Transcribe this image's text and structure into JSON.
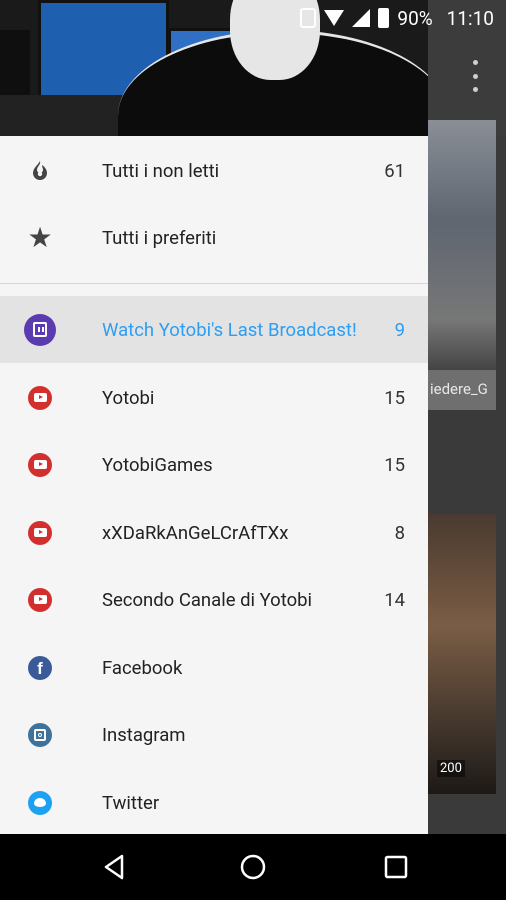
{
  "status_bar": {
    "battery": "90%",
    "time": "11:10"
  },
  "background": {
    "caption_fragment": "iedere_G",
    "video_time": "200"
  },
  "drawer": {
    "items": [
      {
        "label": "Tutti i non letti",
        "count": "61",
        "icon": "flame-icon"
      },
      {
        "label": "Tutti i preferiti",
        "count": "",
        "icon": "star-icon"
      },
      {
        "label": "Watch Yotobi's Last Broadcast!",
        "count": "9",
        "icon": "twitch-icon",
        "active": true
      },
      {
        "label": "Yotobi",
        "count": "15",
        "icon": "youtube-icon"
      },
      {
        "label": "YotobiGames",
        "count": "15",
        "icon": "youtube-icon"
      },
      {
        "label": "xXDaRkAnGeLCrAfTXx",
        "count": "8",
        "icon": "youtube-icon"
      },
      {
        "label": "Secondo Canale di Yotobi",
        "count": "14",
        "icon": "youtube-icon"
      },
      {
        "label": "Facebook",
        "count": "",
        "icon": "facebook-icon"
      },
      {
        "label": "Instagram",
        "count": "",
        "icon": "instagram-icon"
      },
      {
        "label": "Twitter",
        "count": "",
        "icon": "twitter-icon"
      }
    ]
  },
  "colors": {
    "accent": "#2d9ef1",
    "youtube": "#d32f2f",
    "twitch": "#5b3cb0",
    "facebook": "#3b5a9a",
    "instagram": "#3f729b",
    "twitter": "#1da1f2"
  }
}
